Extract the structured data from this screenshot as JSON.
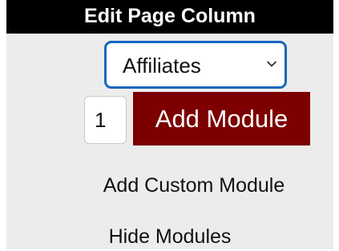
{
  "header": {
    "title": "Edit Page Column"
  },
  "module_select": {
    "selected": "Affiliates",
    "chevron_icon": "chevron-down-icon",
    "border_color": "#1565c0"
  },
  "quantity": {
    "value": "1"
  },
  "add_module_button": {
    "label": "Add Module",
    "color": "#7c0000"
  },
  "links": {
    "add_custom": "Add Custom Module",
    "hide_modules": "Hide Modules"
  }
}
